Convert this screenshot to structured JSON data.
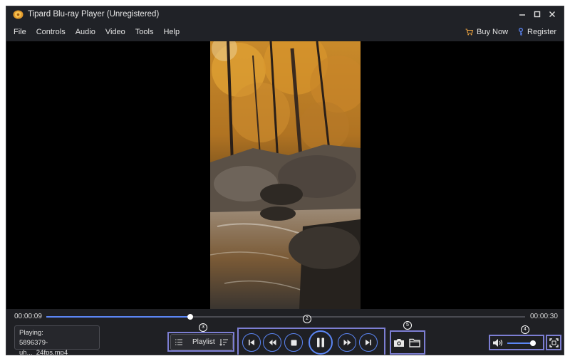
{
  "window": {
    "title": "Tipard Blu-ray Player (Unregistered)",
    "controls": [
      "minimize-icon",
      "maximize-icon",
      "close-icon"
    ]
  },
  "menu": {
    "items": [
      "File",
      "Controls",
      "Audio",
      "Video",
      "Tools",
      "Help"
    ],
    "buy_now": "Buy Now",
    "register": "Register"
  },
  "player": {
    "elapsed": "00:00:09",
    "total": "00:00:30",
    "progress_fraction": 0.3,
    "volume_fraction": 0.9,
    "playing_label": "Playing:",
    "file_name": "5896379-uh..._24fps.mp4",
    "playlist_label": "Playlist"
  },
  "annotations": [
    "2",
    "3",
    "4",
    "5"
  ],
  "colors": {
    "accent": "#5b86f5",
    "highlight": "#7c7ed3",
    "background": "#1c1d21"
  },
  "icons": {
    "transport": [
      "skip-previous-icon",
      "rewind-icon",
      "stop-icon",
      "pause-icon",
      "fast-forward-icon",
      "skip-next-icon"
    ],
    "tools": [
      "snapshot-camera-icon",
      "open-folder-icon"
    ]
  }
}
